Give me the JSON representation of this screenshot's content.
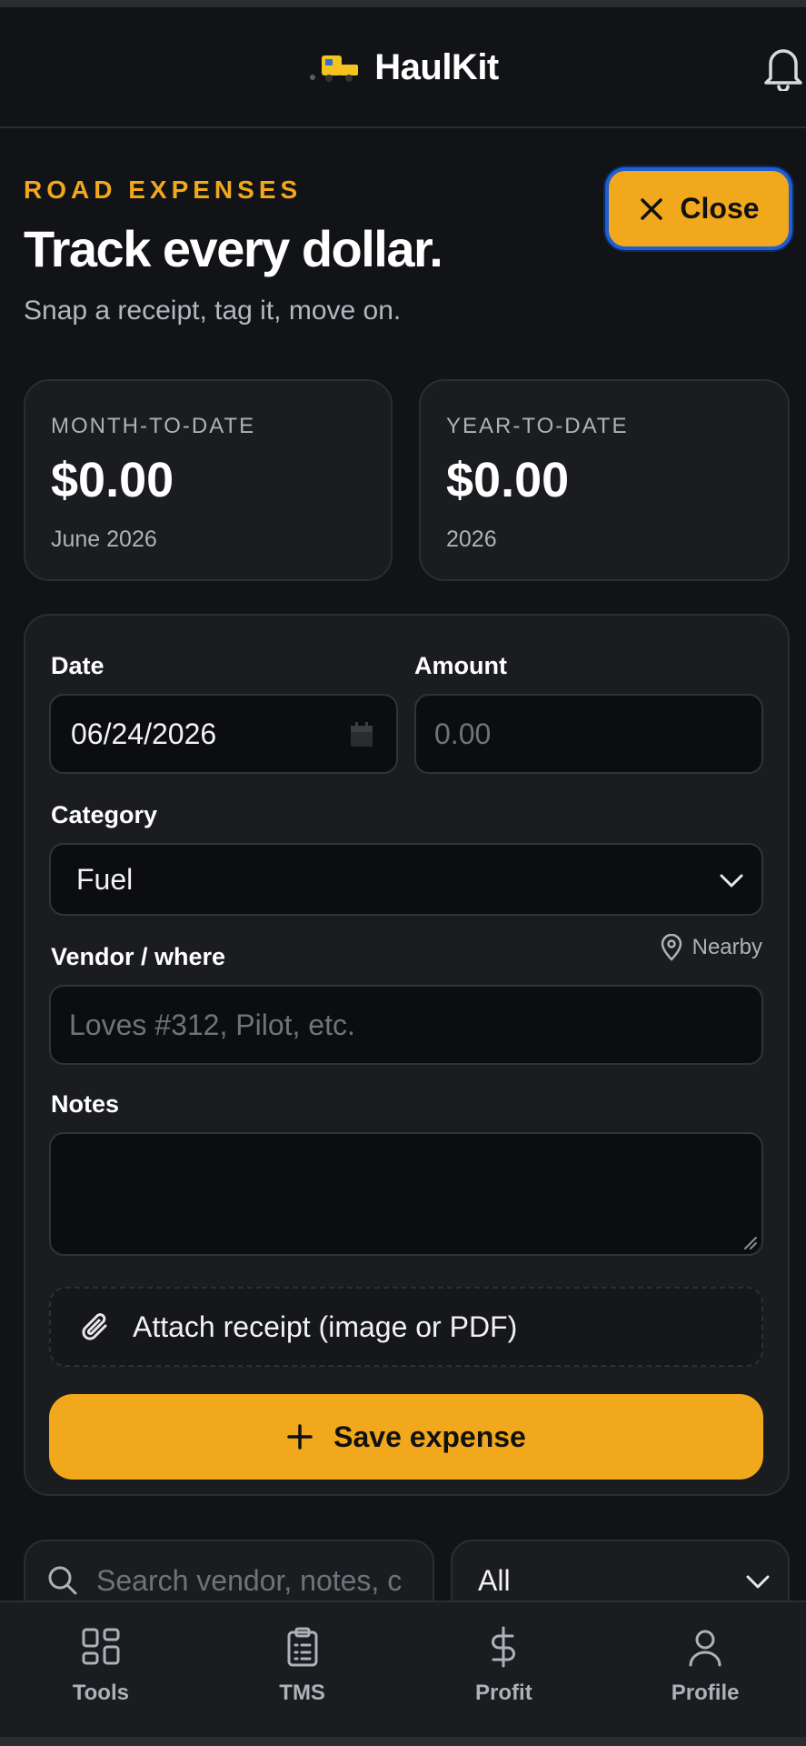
{
  "header": {
    "app_name": "HaulKit",
    "logo_icon": "truck-icon",
    "notification_icon": "bell-icon"
  },
  "page": {
    "eyebrow": "ROAD EXPENSES",
    "title": "Track every dollar.",
    "subtitle": "Snap a receipt, tag it, move on.",
    "close_label": "Close"
  },
  "stats": {
    "month": {
      "label": "MONTH-TO-DATE",
      "value": "$0.00",
      "sub": "June 2026"
    },
    "year": {
      "label": "YEAR-TO-DATE",
      "value": "$0.00",
      "sub": "2026"
    }
  },
  "form": {
    "date_label": "Date",
    "date_value": "06/24/2026",
    "amount_label": "Amount",
    "amount_placeholder": "0.00",
    "category_label": "Category",
    "category_value": "Fuel",
    "vendor_label": "Vendor / where",
    "nearby_label": "Nearby",
    "vendor_placeholder": "Loves #312, Pilot, etc.",
    "notes_label": "Notes",
    "notes_value": "",
    "attach_label": "Attach receipt (image or PDF)",
    "save_label": "Save expense"
  },
  "list": {
    "search_placeholder": "Search vendor, notes, c",
    "filter_value": "All"
  },
  "tabs": [
    {
      "label": "Tools",
      "icon": "grid-icon"
    },
    {
      "label": "TMS",
      "icon": "clipboard-icon"
    },
    {
      "label": "Profit",
      "icon": "dollar-icon"
    },
    {
      "label": "Profile",
      "icon": "user-icon"
    }
  ],
  "colors": {
    "accent": "#f2a81c",
    "background": "#111316",
    "card": "#1a1c20",
    "focus_ring": "#1f5fd4"
  }
}
